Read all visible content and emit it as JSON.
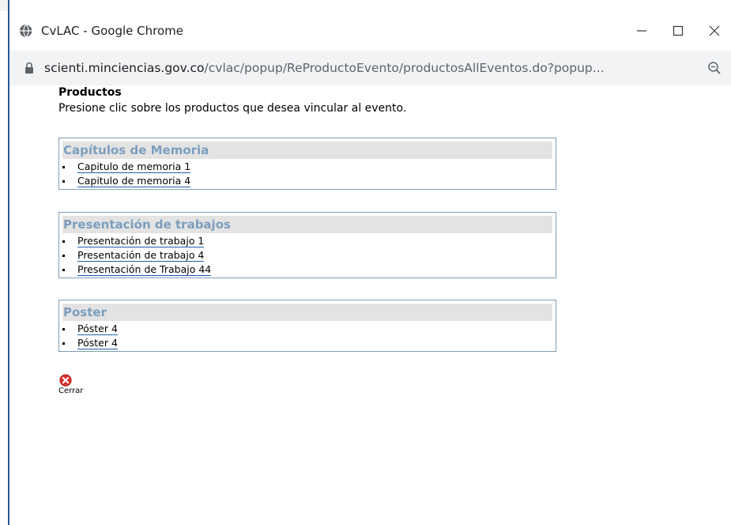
{
  "window": {
    "title": "CvLAC - Google Chrome",
    "minimize": "—",
    "maximize": "☐",
    "close": "✕"
  },
  "url": {
    "host": "scienti.minciencias.gov.co",
    "path": "/cvlac/popup/ReProductoEvento/productosAllEventos.do?popup..."
  },
  "page": {
    "title": "Productos",
    "instruction": "Presione clic sobre los productos que desea vincular al evento."
  },
  "sections": [
    {
      "title": "Capítulos de Memoria",
      "items": [
        "Capitulo de memoria 1",
        "Capitulo de memoria 4"
      ]
    },
    {
      "title": "Presentación de trabajos",
      "items": [
        "Presentación de trabajo 1",
        "Presentación de trabajo 4",
        "Presentación de Trabajo 44"
      ]
    },
    {
      "title": "Poster",
      "items": [
        "Póster 4",
        "Póster 4"
      ]
    }
  ],
  "close": {
    "label": "Cerrar"
  },
  "colors": {
    "section_title": "#7d9ebd",
    "section_border": "#7f9db9",
    "link_underline": "#1f5fa8",
    "close_icon": "#d9302c"
  }
}
